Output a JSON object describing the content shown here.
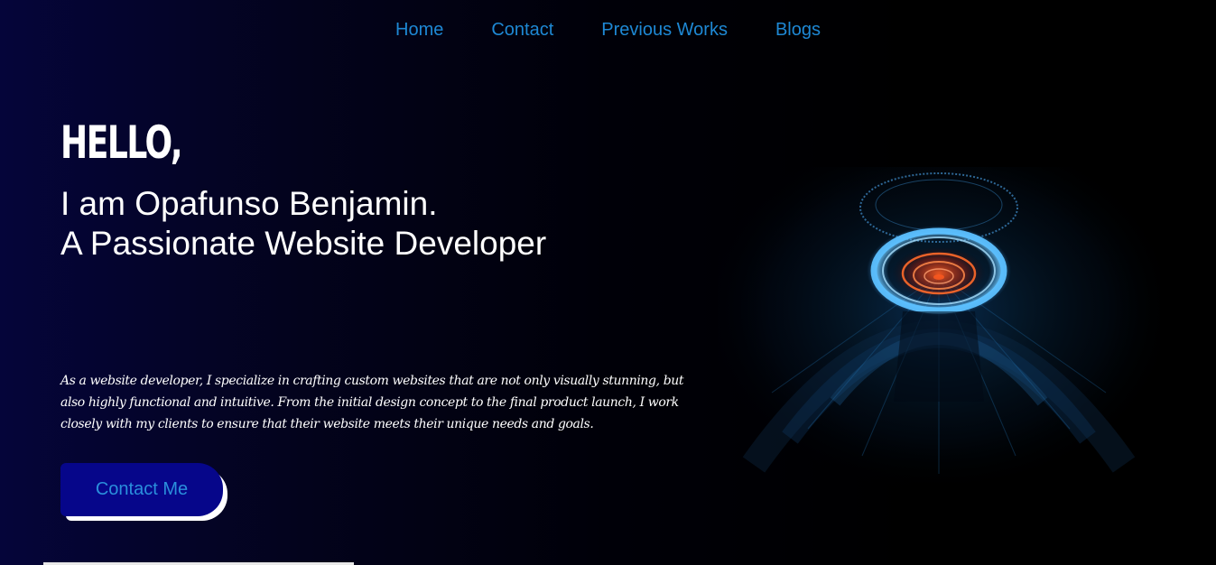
{
  "nav": {
    "items": [
      {
        "label": "Home"
      },
      {
        "label": "Contact"
      },
      {
        "label": "Previous Works"
      },
      {
        "label": "Blogs"
      }
    ]
  },
  "hero": {
    "greeting": "HELLO,",
    "name_line": "I am Opafunso Benjamin.",
    "role_line": "A Passionate Website Developer",
    "description": "As a website developer, I specialize in crafting custom websites that are not only visually stunning, but also highly functional and intuitive. From the initial design concept to the final product launch, I work closely with my clients to ensure that their website meets their unique needs and goals.",
    "cta_label": "Contact Me",
    "graphic_icon": "tech-portal-graphic"
  },
  "colors": {
    "nav_link": "#1e88d4",
    "cta_background": "#06068a",
    "cta_text": "#2a8fdc",
    "glow_blue": "#4fb6ff",
    "glow_orange": "#ff6a2a"
  }
}
